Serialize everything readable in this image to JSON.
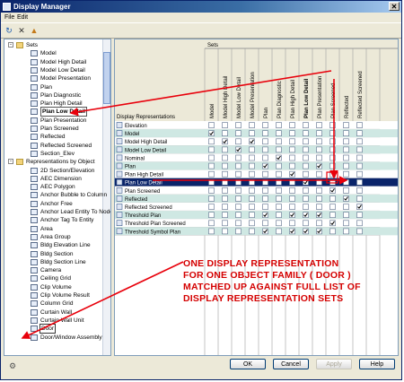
{
  "window": {
    "title": "Display Manager",
    "close_glyph": "✕"
  },
  "menu": {
    "file": "File",
    "edit": "Edit"
  },
  "toolbar": [
    {
      "icon": "refresh-icon",
      "glyph": "↻"
    },
    {
      "icon": "delete-icon",
      "glyph": "✕"
    },
    {
      "icon": "purge-icon",
      "glyph": "▲"
    }
  ],
  "tree": {
    "items": [
      {
        "label": "Sets",
        "level": 1,
        "folder": true,
        "expand": "-"
      },
      {
        "label": "Model",
        "level": 2
      },
      {
        "label": "Model High Detail",
        "level": 2
      },
      {
        "label": "Model Low Detail",
        "level": 2
      },
      {
        "label": "Model Presentation",
        "level": 2
      },
      {
        "label": "Plan",
        "level": 2
      },
      {
        "label": "Plan Diagnostic",
        "level": 2
      },
      {
        "label": "Plan High Detail",
        "level": 2
      },
      {
        "label": "Plan Low Detail",
        "level": 2,
        "selected": true
      },
      {
        "label": "Plan Presentation",
        "level": 2
      },
      {
        "label": "Plan Screened",
        "level": 2
      },
      {
        "label": "Reflected",
        "level": 2
      },
      {
        "label": "Reflected Screened",
        "level": 2
      },
      {
        "label": "Section_Elev",
        "level": 2
      },
      {
        "label": "Representations by Object",
        "level": 1,
        "folder": true,
        "expand": "-"
      },
      {
        "label": "2D Section/Elevation",
        "level": 2
      },
      {
        "label": "AEC Dimension",
        "level": 2
      },
      {
        "label": "AEC Polygon",
        "level": 2
      },
      {
        "label": "Anchor Bubble to Column",
        "level": 2
      },
      {
        "label": "Anchor Free",
        "level": 2
      },
      {
        "label": "Anchor Lead Entity To Node",
        "level": 2
      },
      {
        "label": "Anchor Tag To Entity",
        "level": 2
      },
      {
        "label": "Area",
        "level": 2
      },
      {
        "label": "Area Group",
        "level": 2
      },
      {
        "label": "Bldg Elevation Line",
        "level": 2
      },
      {
        "label": "Bldg Section",
        "level": 2
      },
      {
        "label": "Bldg Section Line",
        "level": 2
      },
      {
        "label": "Camera",
        "level": 2
      },
      {
        "label": "Ceiling Grid",
        "level": 2
      },
      {
        "label": "Clip Volume",
        "level": 2
      },
      {
        "label": "Clip Volume Result",
        "level": 2
      },
      {
        "label": "Column Grid",
        "level": 2
      },
      {
        "label": "Curtain Wall",
        "level": 2
      },
      {
        "label": "Curtain Wall Unit",
        "level": 2
      },
      {
        "label": "Door",
        "level": 2,
        "boxed": true
      },
      {
        "label": "Door/Window Assembly",
        "level": 2
      }
    ]
  },
  "grid": {
    "sets_header": "Sets",
    "rep_header": "Display Representations",
    "columns": [
      "Model",
      "Model High Detail",
      "Model Low Detail",
      "Model Presentation",
      "Plan",
      "Plan Diagnostic",
      "Plan High Detail",
      "Plan Low Detail",
      "Plan Presentation",
      "Plan Screened",
      "Reflected",
      "Reflected Screened"
    ],
    "bold_column": 7,
    "rows": [
      {
        "label": "Elevation",
        "checks": [
          0,
          0,
          0,
          0,
          0,
          0,
          0,
          0,
          0,
          0,
          0,
          0
        ]
      },
      {
        "label": "Model",
        "checks": [
          1,
          0,
          0,
          0,
          0,
          0,
          0,
          0,
          0,
          0,
          0,
          0
        ]
      },
      {
        "label": "Model High Detail",
        "checks": [
          0,
          1,
          0,
          1,
          0,
          0,
          0,
          0,
          0,
          0,
          0,
          0
        ]
      },
      {
        "label": "Model Low Detail",
        "checks": [
          0,
          0,
          1,
          0,
          0,
          0,
          0,
          0,
          0,
          0,
          0,
          0
        ]
      },
      {
        "label": "Nominal",
        "checks": [
          0,
          0,
          0,
          0,
          0,
          1,
          0,
          0,
          0,
          0,
          0,
          0
        ]
      },
      {
        "label": "Plan",
        "checks": [
          0,
          0,
          0,
          0,
          1,
          0,
          0,
          0,
          1,
          0,
          0,
          0
        ]
      },
      {
        "label": "Plan High Detail",
        "checks": [
          0,
          0,
          0,
          0,
          0,
          0,
          1,
          0,
          0,
          0,
          0,
          0
        ]
      },
      {
        "label": "Plan Low Detail",
        "checks": [
          0,
          0,
          0,
          0,
          0,
          0,
          0,
          1,
          0,
          0,
          0,
          0
        ],
        "selected": true
      },
      {
        "label": "Plan Screened",
        "checks": [
          0,
          0,
          0,
          0,
          0,
          0,
          0,
          0,
          0,
          1,
          0,
          0
        ]
      },
      {
        "label": "Reflected",
        "checks": [
          0,
          0,
          0,
          0,
          0,
          0,
          0,
          0,
          0,
          0,
          1,
          0
        ]
      },
      {
        "label": "Reflected Screened",
        "checks": [
          0,
          0,
          0,
          0,
          0,
          0,
          0,
          0,
          0,
          0,
          0,
          1
        ]
      },
      {
        "label": "Threshold Plan",
        "checks": [
          0,
          0,
          0,
          0,
          1,
          0,
          1,
          1,
          1,
          0,
          0,
          0
        ]
      },
      {
        "label": "Threshold Plan Screened",
        "checks": [
          0,
          0,
          0,
          0,
          0,
          0,
          0,
          0,
          0,
          1,
          0,
          0
        ]
      },
      {
        "label": "Threshold Symbol Plan",
        "checks": [
          0,
          0,
          0,
          0,
          1,
          0,
          1,
          1,
          1,
          0,
          0,
          0
        ]
      }
    ]
  },
  "annotation": [
    "ONE DISPLAY REPRESENTATION",
    "FOR ONE OBJECT FAMILY ( DOOR )",
    "MATCHED UP AGAINST FULL LIST OF",
    "DISPLAY REPRESENTATION SETS"
  ],
  "buttons": {
    "ok": "OK",
    "cancel": "Cancel",
    "apply": "Apply",
    "help": "Help"
  },
  "colors": {
    "stripe": "#cfe8e3",
    "selection": "#0a246a",
    "annotation": "#d40000",
    "arrow": "#e8000b"
  }
}
